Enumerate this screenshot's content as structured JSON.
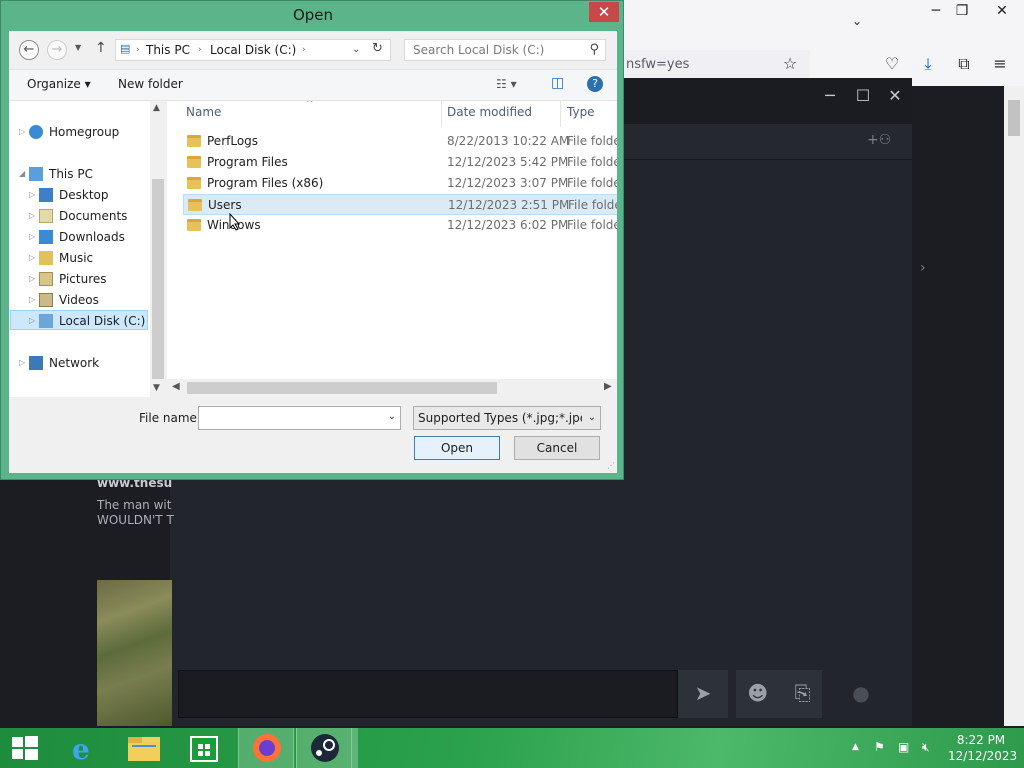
{
  "browser": {
    "url_fragment": "nsfw=yes",
    "icons": [
      "chevron-down-icon",
      "star-icon",
      "pocket-icon",
      "download-icon",
      "extensions-icon",
      "menu-icon"
    ]
  },
  "chat": {
    "link_text": "www.thesu",
    "message_line1": "The man wit",
    "message_line2": "WOULDN'T T"
  },
  "dialog": {
    "title": "Open",
    "close_label": "✕",
    "address": {
      "crumbs": [
        "This PC",
        "Local Disk (C:)"
      ]
    },
    "search_placeholder": "Search Local Disk (C:)",
    "toolbar": {
      "organize_label": "Organize ▾",
      "new_folder_label": "New folder"
    },
    "nav_pane": {
      "items": [
        {
          "label": "Homegroup"
        },
        {
          "label": "This PC"
        },
        {
          "label": "Desktop"
        },
        {
          "label": "Documents"
        },
        {
          "label": "Downloads"
        },
        {
          "label": "Music"
        },
        {
          "label": "Pictures"
        },
        {
          "label": "Videos"
        },
        {
          "label": "Local Disk (C:)"
        },
        {
          "label": "Network"
        }
      ],
      "selected": "Local Disk (C:)"
    },
    "columns": [
      "Name",
      "Date modified",
      "Type"
    ],
    "files": [
      {
        "name": "PerfLogs",
        "date": "8/22/2013 10:22 AM",
        "type": "File folder"
      },
      {
        "name": "Program Files",
        "date": "12/12/2023 5:42 PM",
        "type": "File folder"
      },
      {
        "name": "Program Files (x86)",
        "date": "12/12/2023 3:07 PM",
        "type": "File folder"
      },
      {
        "name": "Users",
        "date": "12/12/2023 2:51 PM",
        "type": "File folder"
      },
      {
        "name": "Windows",
        "date": "12/12/2023 6:02 PM",
        "type": "File folder"
      }
    ],
    "selected_file": "Users",
    "file_name_label": "File name:",
    "file_name_value": "",
    "file_type_value": "Supported Types (*.jpg;*.jpeg;*",
    "open_label": "Open",
    "cancel_label": "Cancel"
  },
  "taskbar": {
    "apps": [
      "start-icon",
      "internet-explorer-icon",
      "file-explorer-icon",
      "store-icon",
      "firefox-icon",
      "steam-icon"
    ],
    "time": "8:22 PM",
    "date": "12/12/2023"
  }
}
